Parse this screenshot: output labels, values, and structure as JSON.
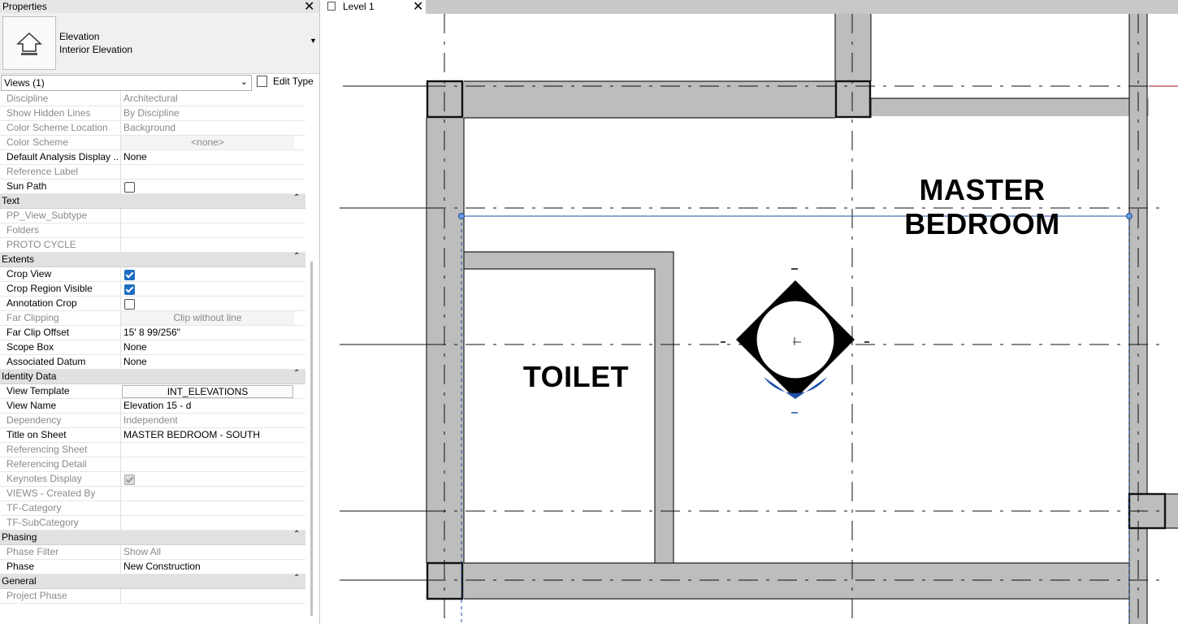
{
  "properties_panel": {
    "title": "Properties",
    "type_selector": {
      "family": "Elevation",
      "type": "Interior Elevation",
      "icon": "elevation-house-icon"
    },
    "filter": "Views (1)",
    "edit_type_label": "Edit Type",
    "rows": [
      {
        "kind": "row",
        "name": "Discipline",
        "value": "Architectural",
        "disabled": true
      },
      {
        "kind": "row",
        "name": "Show Hidden Lines",
        "value": "By Discipline",
        "disabled": true
      },
      {
        "kind": "row",
        "name": "Color Scheme Location",
        "value": "Background",
        "disabled": true
      },
      {
        "kind": "row",
        "name": "Color Scheme",
        "value": "<none>",
        "disabled": true,
        "style": "center-grey"
      },
      {
        "kind": "row",
        "name": "Default Analysis Display ...",
        "value": "None"
      },
      {
        "kind": "row",
        "name": "Reference Label",
        "value": "",
        "disabled": true
      },
      {
        "kind": "check",
        "name": "Sun Path",
        "checked": false
      },
      {
        "kind": "section",
        "name": "Text"
      },
      {
        "kind": "row",
        "name": "PP_View_Subtype",
        "value": "",
        "disabled": true
      },
      {
        "kind": "row",
        "name": "Folders",
        "value": "",
        "disabled": true
      },
      {
        "kind": "row",
        "name": "PROTO CYCLE",
        "value": "",
        "disabled": true
      },
      {
        "kind": "section",
        "name": "Extents"
      },
      {
        "kind": "check",
        "name": "Crop View",
        "checked": true
      },
      {
        "kind": "check",
        "name": "Crop Region Visible",
        "checked": true
      },
      {
        "kind": "check",
        "name": "Annotation Crop",
        "checked": false
      },
      {
        "kind": "row",
        "name": "Far Clipping",
        "value": "Clip without line",
        "disabled": true,
        "style": "center-grey"
      },
      {
        "kind": "row",
        "name": "Far Clip Offset",
        "value": "15'  8 99/256\""
      },
      {
        "kind": "row",
        "name": "Scope Box",
        "value": "None"
      },
      {
        "kind": "row",
        "name": "Associated Datum",
        "value": "None"
      },
      {
        "kind": "section",
        "name": "Identity Data"
      },
      {
        "kind": "row",
        "name": "View Template",
        "value": "INT_ELEVATIONS",
        "style": "button"
      },
      {
        "kind": "row",
        "name": "View Name",
        "value": "Elevation 15 - d"
      },
      {
        "kind": "row",
        "name": "Dependency",
        "value": "Independent",
        "disabled": true
      },
      {
        "kind": "row",
        "name": "Title on Sheet",
        "value": "MASTER BEDROOM - SOUTH"
      },
      {
        "kind": "row",
        "name": "Referencing Sheet",
        "value": "",
        "disabled": true
      },
      {
        "kind": "row",
        "name": "Referencing Detail",
        "value": "",
        "disabled": true
      },
      {
        "kind": "check",
        "name": "Keynotes Display",
        "checked": true,
        "disabled": true
      },
      {
        "kind": "row",
        "name": "VIEWS - Created By",
        "value": "",
        "disabled": true
      },
      {
        "kind": "row",
        "name": "TF-Category",
        "value": "",
        "disabled": true
      },
      {
        "kind": "row",
        "name": "TF-SubCategory",
        "value": "",
        "disabled": true
      },
      {
        "kind": "section",
        "name": "Phasing"
      },
      {
        "kind": "row",
        "name": "Phase Filter",
        "value": "Show All",
        "disabled": true
      },
      {
        "kind": "row",
        "name": "Phase",
        "value": "New Construction"
      },
      {
        "kind": "section",
        "name": "General"
      },
      {
        "kind": "row",
        "name": "Project Phase",
        "value": "",
        "disabled": true
      }
    ]
  },
  "view_tab": {
    "label": "Level 1",
    "icon": "floor-plan-icon"
  },
  "rooms": {
    "master": "MASTER\nBEDROOM",
    "toilet": "TOILET"
  },
  "colors": {
    "wall_fill": "#bdbdbd",
    "selection": "#1b4fa8",
    "section_header": "#e1e1e1"
  }
}
